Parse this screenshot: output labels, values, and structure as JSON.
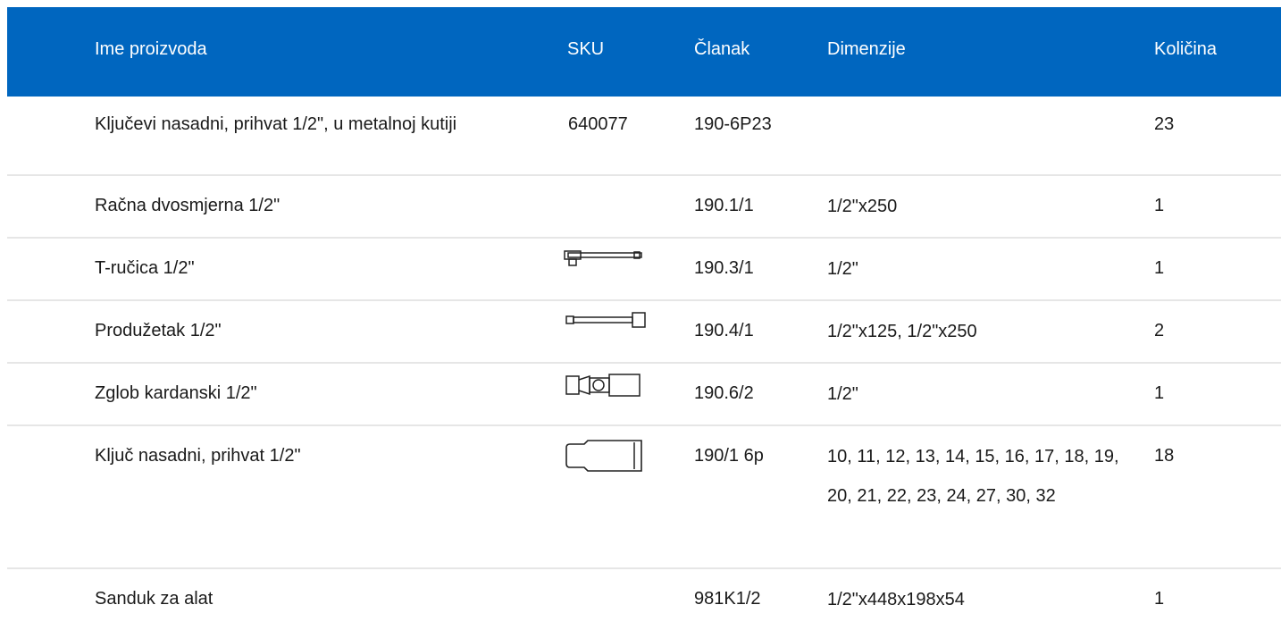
{
  "header": {
    "name": "Ime proizvoda",
    "sku": "SKU",
    "article": "Članak",
    "dimensions": "Dimenzije",
    "quantity": "Količina"
  },
  "rows": [
    {
      "name": "Ključevi nasadni, prihvat 1/2\", u metalnoj kutiji",
      "sku": "640077",
      "article": "190-6P23",
      "dimensions": "",
      "quantity": "23",
      "icon": ""
    },
    {
      "name": "Račna dvosmjerna 1/2\"",
      "sku": "",
      "article": "190.1/1",
      "dimensions": "1/2\"x250",
      "quantity": "1",
      "icon": ""
    },
    {
      "name": "T-ručica 1/2\"",
      "sku": "",
      "article": "190.3/1",
      "dimensions": "1/2\"",
      "quantity": "1",
      "icon": "t-handle-icon"
    },
    {
      "name": "Produžetak 1/2\"",
      "sku": "",
      "article": "190.4/1",
      "dimensions": "1/2\"x125, 1/2\"x250",
      "quantity": "2",
      "icon": "extension-bar-icon"
    },
    {
      "name": "Zglob kardanski 1/2\"",
      "sku": "",
      "article": "190.6/2",
      "dimensions": "1/2\"",
      "quantity": "1",
      "icon": "universal-joint-icon"
    },
    {
      "name": "Ključ nasadni, prihvat 1/2\"",
      "sku": "",
      "article": "190/1 6p",
      "dimensions": "10, 11, 12, 13, 14, 15, 16, 17, 18, 19, 20, 21, 22, 23, 24, 27, 30, 32",
      "quantity": "18",
      "icon": "socket-icon"
    },
    {
      "name": "Sanduk za alat",
      "sku": "",
      "article": "981K1/2",
      "dimensions": "1/2\"x448x198x54",
      "quantity": "1",
      "icon": ""
    }
  ],
  "colors": {
    "header_bg": "#0066bf",
    "divider": "#e6e6e6"
  }
}
